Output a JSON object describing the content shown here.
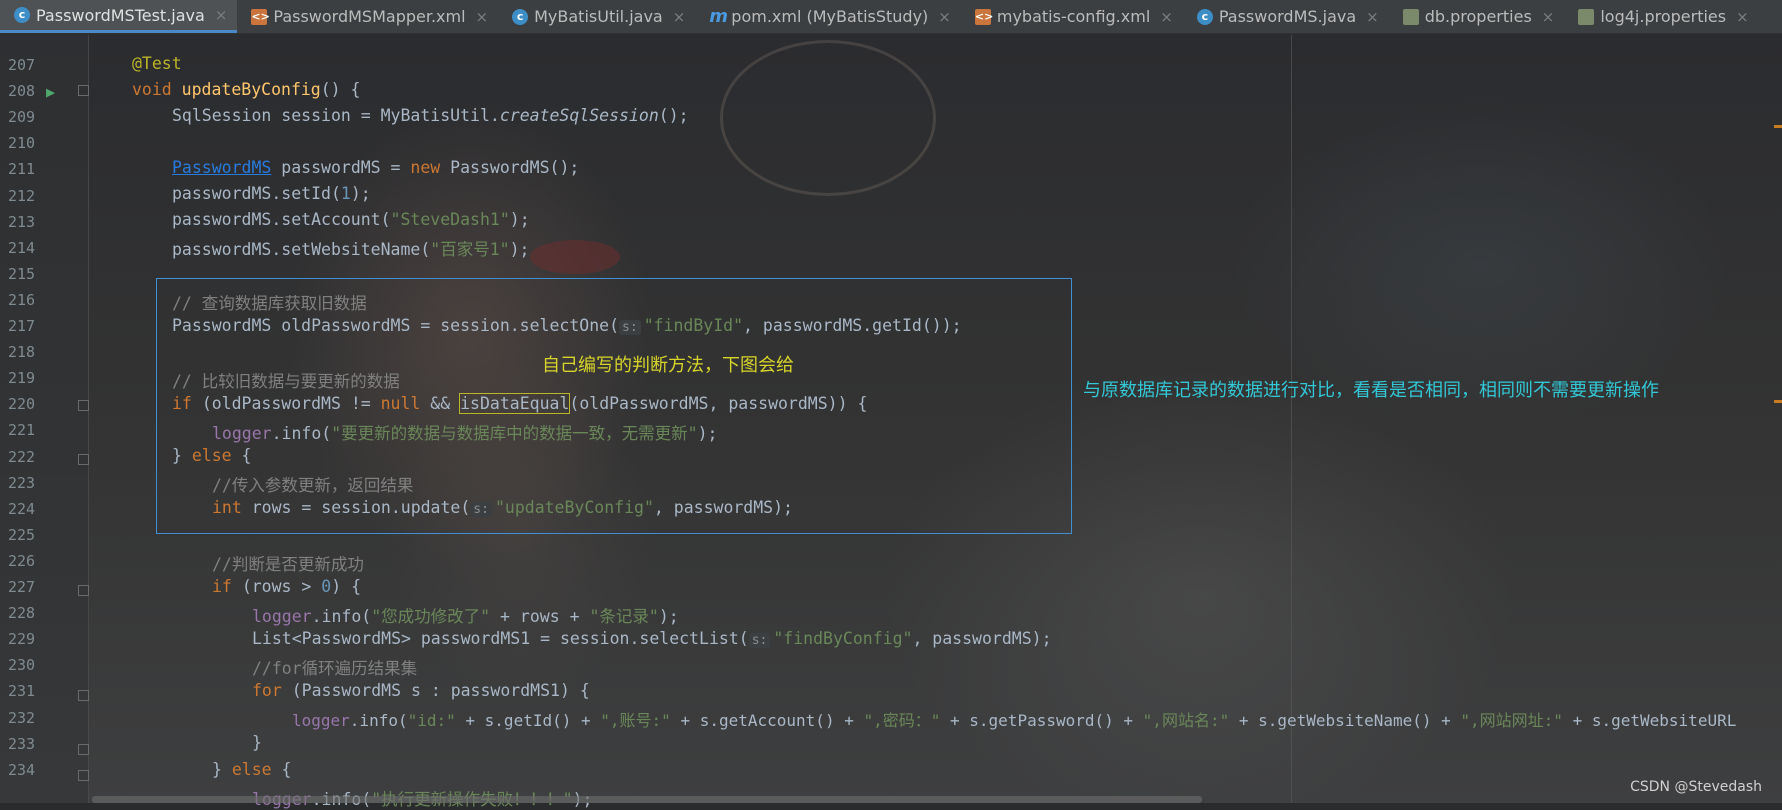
{
  "tabs": [
    {
      "label": "PasswordMSTest.java",
      "icon": "class-icon",
      "active": true
    },
    {
      "label": "PasswordMSMapper.xml",
      "icon": "xml-icon"
    },
    {
      "label": "MyBatisUtil.java",
      "icon": "class-icon"
    },
    {
      "label": "pom.xml (MyBatisStudy)",
      "icon": "maven-icon"
    },
    {
      "label": "mybatis-config.xml",
      "icon": "xml-icon"
    },
    {
      "label": "PasswordMS.java",
      "icon": "class-icon"
    },
    {
      "label": "db.properties",
      "icon": "properties-icon"
    },
    {
      "label": "log4j.properties",
      "icon": "properties-icon"
    }
  ],
  "close_glyph": "×",
  "line_numbers": [
    "207",
    "208",
    "209",
    "210",
    "211",
    "212",
    "213",
    "214",
    "215",
    "216",
    "217",
    "218",
    "219",
    "220",
    "221",
    "222",
    "223",
    "224",
    "225",
    "226",
    "227",
    "228",
    "229",
    "230",
    "231",
    "232",
    "233",
    "234"
  ],
  "code": {
    "l207": "@Test",
    "l208_kw": "void ",
    "l208_fn": "updateByConfig",
    "l208_rest": "() {",
    "l209_a": "SqlSession session = MyBatisUtil.",
    "l209_b": "createSqlSession",
    "l209_c": "();",
    "l211_a": "PasswordMS",
    "l211_b": " passwordMS = ",
    "l211_c": "new ",
    "l211_d": "PasswordMS();",
    "l212_a": "passwordMS.setId(",
    "l212_b": "1",
    "l212_c": ");",
    "l213_a": "passwordMS.setAccount(",
    "l213_b": "\"SteveDash1\"",
    "l213_c": ");",
    "l214_a": "passwordMS.setWebsiteName(",
    "l214_b": "\"百家号1\"",
    "l214_c": ");",
    "l216": "// 查询数据库获取旧数据",
    "l217_a": "PasswordMS oldPasswordMS = session.selectOne(",
    "l217_h": "s:",
    "l217_b": "\"findById\"",
    "l217_c": ", passwordMS.getId());",
    "l219": "// 比较旧数据与要更新的数据",
    "l220_kw": "if ",
    "l220_a": "(oldPasswordMS != ",
    "l220_null": "null ",
    "l220_b": "&& ",
    "l220_fn": "isDataEqual",
    "l220_c": "(oldPasswordMS, passwordMS)) {",
    "l221_a": "logger",
    "l221_b": ".info(",
    "l221_s": "\"要更新的数据与数据库中的数据一致，无需更新\"",
    "l221_c": ");",
    "l222_a": "} ",
    "l222_kw": "else ",
    "l222_b": "{",
    "l223": "//传入参数更新，返回结果",
    "l224_kw": "int ",
    "l224_a": "rows = session.update(",
    "l224_h": "s:",
    "l224_s": "\"updateByConfig\"",
    "l224_b": ", passwordMS);",
    "l226": "//判断是否更新成功",
    "l227_kw": "if ",
    "l227_a": "(rows > ",
    "l227_n": "0",
    "l227_b": ") {",
    "l228_a": "logger",
    "l228_b": ".info(",
    "l228_s1": "\"您成功修改了\"",
    "l228_c": " + rows + ",
    "l228_s2": "\"条记录\"",
    "l228_d": ");",
    "l229_a": "List<PasswordMS> passwordMS1 = session.selectList(",
    "l229_h": "s:",
    "l229_s": "\"findByConfig\"",
    "l229_b": ", passwordMS);",
    "l230": "//for循环遍历结果集",
    "l231_kw": "for ",
    "l231_a": "(PasswordMS s : passwordMS1) {",
    "l232_a": "logger",
    "l232_b": ".info(",
    "l232_s1": "\"id:\"",
    "l232_c": " + s.getId() + ",
    "l232_s2": "\",账号:\"",
    "l232_d": " + s.getAccount() + ",
    "l232_s3": "\",密码：\"",
    "l232_e": " + s.getPassword() + ",
    "l232_s4": "\",网站名:\"",
    "l232_f": " + s.getWebsiteName() + ",
    "l232_s5": "\",网站网址:\"",
    "l232_g": " + s.getWebsiteURL",
    "l233": "}",
    "l234_a": "} ",
    "l234_kw": "else ",
    "l234_b": "{",
    "l235_a": "logger",
    "l235_b": ".info(",
    "l235_s": "\"执行更新操作失败！！！\"",
    "l235_c": ");"
  },
  "annotations": {
    "method_note": "自己编写的判断方法，下图会给",
    "compare_note": "与原数据库记录的数据进行对比，看看是否相同，相同则不需要更新操作"
  },
  "watermark": "CSDN @Stevedash"
}
